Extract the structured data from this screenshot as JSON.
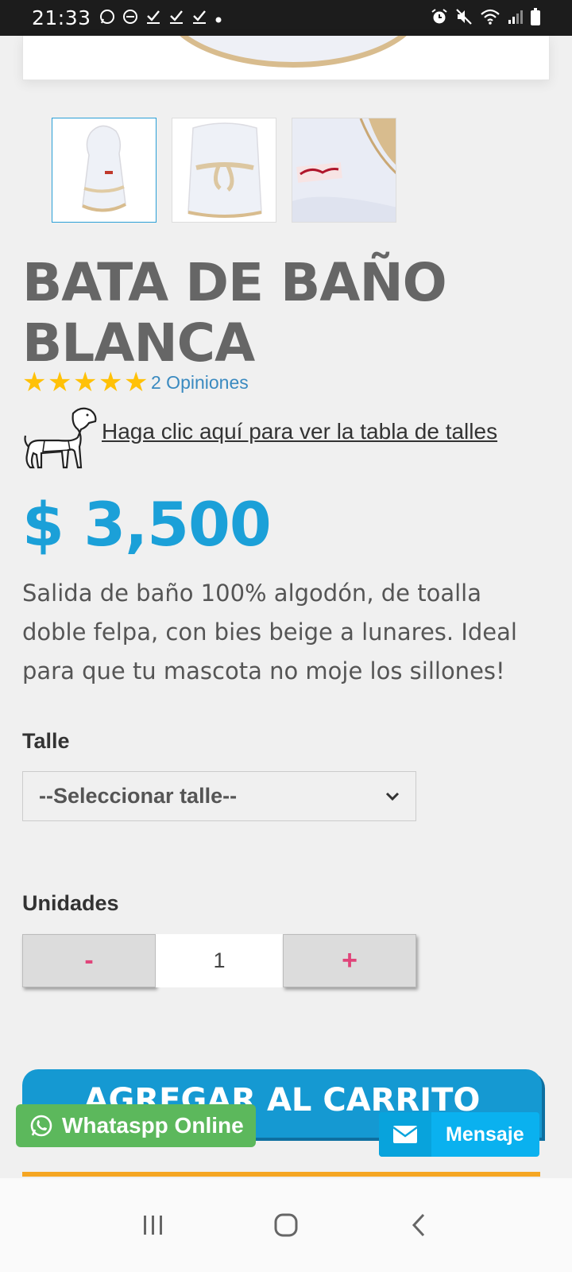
{
  "status_bar": {
    "time": "21:33",
    "left_icons": [
      "whatsapp-icon",
      "do-not-disturb-icon",
      "check-icon",
      "check-icon",
      "check-icon",
      "dot-icon"
    ],
    "right_icons": [
      "alarm-icon",
      "mute-icon",
      "wifi-icon",
      "signal-icon",
      "battery-icon"
    ]
  },
  "product": {
    "title": "BATA DE BAÑO BLANCA",
    "rating_stars": 5,
    "opinions_link": "2 Opiniones",
    "size_chart_link": "Haga clic aquí para ver la tabla de talles",
    "price": "$ 3,500",
    "description": "Salida de baño 100% algodón, de toalla doble felpa, con bies beige a lunares. Ideal para que tu mascota no moje los sillones!"
  },
  "options": {
    "size_label": "Talle",
    "size_selected": "--Seleccionar talle--",
    "units_label": "Unidades",
    "minus_label": "-",
    "plus_label": "+",
    "quantity": "1"
  },
  "actions": {
    "add_to_cart": "AGREGAR AL CARRITO",
    "whatsapp": "Whataspp Online",
    "message": "Mensaje"
  },
  "colors": {
    "accent": "#1599d2",
    "price": "#1ba0d8",
    "star": "#ffc107",
    "whatsapp": "#5cb85c",
    "message": "#0ab1ef",
    "stepper_sign": "#e0457a",
    "divider": "#f5a623"
  }
}
